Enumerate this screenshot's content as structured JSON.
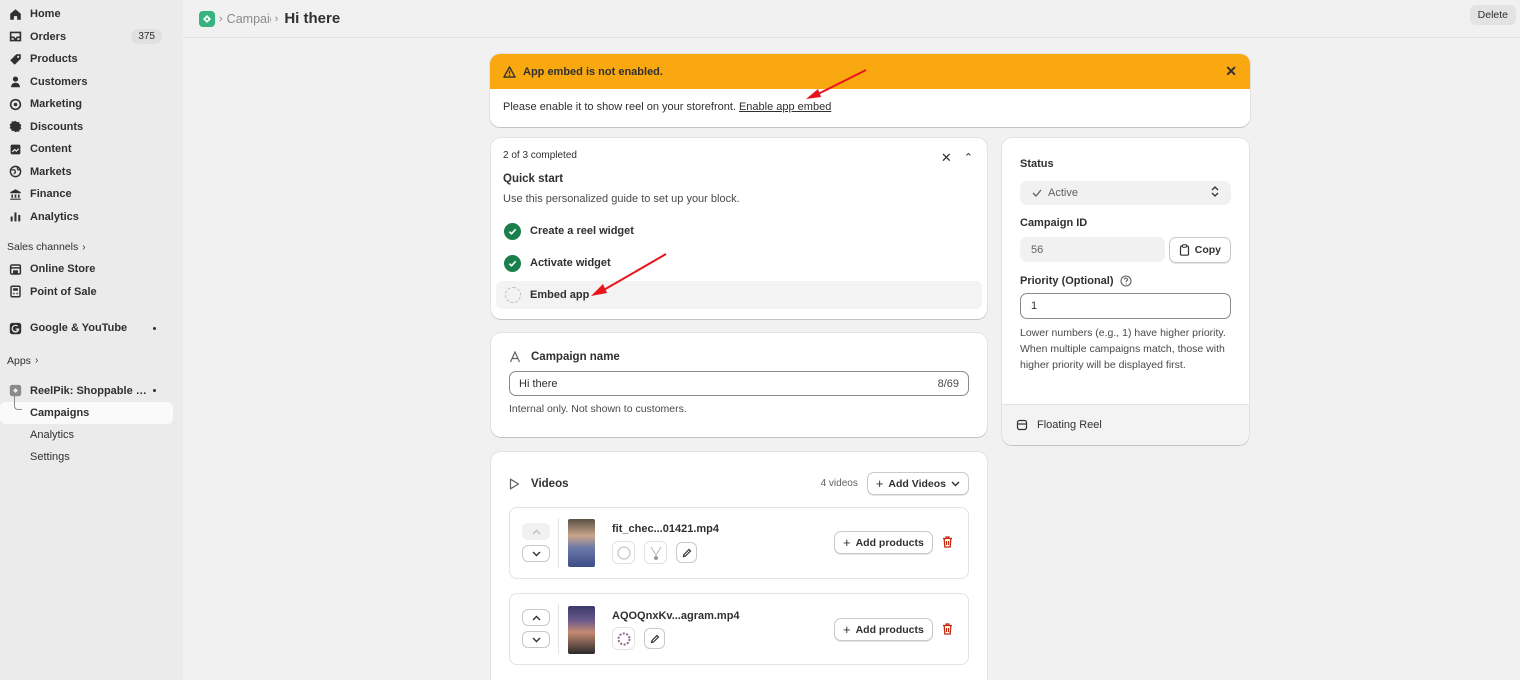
{
  "sidebar": {
    "items": [
      {
        "label": "Home",
        "icon": "home-icon"
      },
      {
        "label": "Orders",
        "icon": "orders-icon",
        "badge": "375"
      },
      {
        "label": "Products",
        "icon": "tag-icon"
      },
      {
        "label": "Customers",
        "icon": "person-icon"
      },
      {
        "label": "Marketing",
        "icon": "target-icon"
      },
      {
        "label": "Discounts",
        "icon": "discount-icon"
      },
      {
        "label": "Content",
        "icon": "content-icon"
      },
      {
        "label": "Markets",
        "icon": "globe-icon"
      },
      {
        "label": "Finance",
        "icon": "bank-icon"
      },
      {
        "label": "Analytics",
        "icon": "bar-chart-icon"
      }
    ],
    "sales_channels_label": "Sales channels",
    "channels": [
      {
        "label": "Online Store",
        "icon": "store-icon"
      },
      {
        "label": "Point of Sale",
        "icon": "pos-icon"
      }
    ],
    "google_label": "Google & YouTube",
    "apps_label": "Apps",
    "app_name": "ReelPik: Shoppable Vi...",
    "app_sub": [
      "Campaigns",
      "Analytics",
      "Settings"
    ]
  },
  "topbar": {
    "crumb": "Campaigns",
    "title": "Hi there",
    "delete": "Delete"
  },
  "banner": {
    "title": "App embed is not enabled.",
    "body": "Please enable it to show reel on your storefront.",
    "link": "Enable app embed",
    "bg": "#f9a90f"
  },
  "quickstart": {
    "progress": "2 of 3 completed",
    "title": "Quick start",
    "subtitle": "Use this personalized guide to set up your block.",
    "steps": [
      {
        "label": "Create a reel widget",
        "done": true
      },
      {
        "label": "Activate widget",
        "done": true
      },
      {
        "label": "Embed app",
        "done": false
      }
    ]
  },
  "campaign": {
    "heading": "Campaign name",
    "value": "Hi there",
    "counter": "8/69",
    "help": "Internal only. Not shown to customers."
  },
  "videos": {
    "heading": "Videos",
    "count": "4 videos",
    "add_button": "Add Videos",
    "add_products": "Add products",
    "rows": [
      {
        "name": "fit_chec...01421.mp4"
      },
      {
        "name": "AQOQnxKv...agram.mp4"
      }
    ]
  },
  "side": {
    "status_label": "Status",
    "status_value": "Active",
    "campaign_id_label": "Campaign ID",
    "campaign_id": "56",
    "copy": "Copy",
    "priority_label": "Priority (Optional)",
    "priority_value": "1",
    "priority_help": "Lower numbers (e.g., 1) have higher priority. When multiple campaigns match, those with higher priority will be displayed first.",
    "footer": "Floating Reel"
  },
  "colors": {
    "accent_green": "#1a7f4b",
    "warning": "#f9a90f",
    "danger": "#c5280c",
    "annotation_red": "#e8141b"
  }
}
